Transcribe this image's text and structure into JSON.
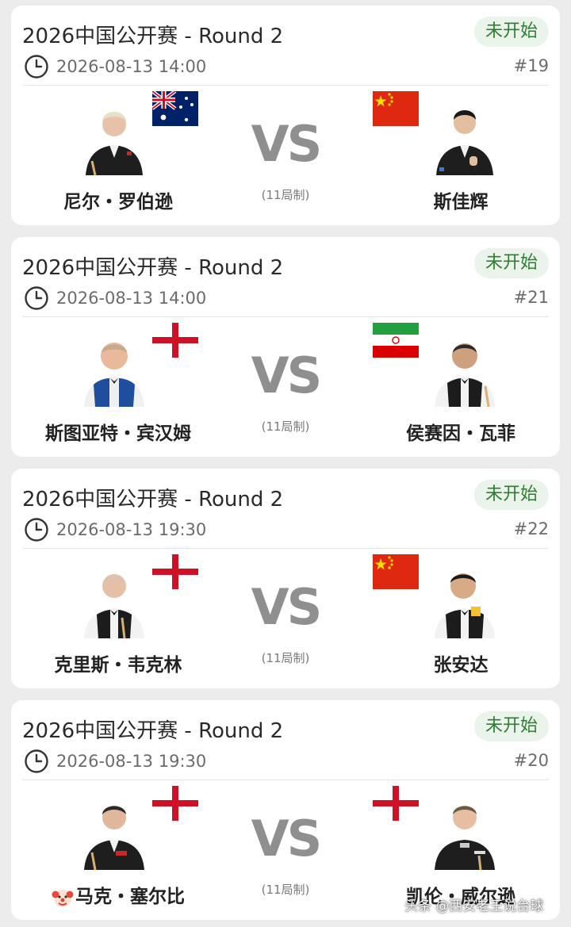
{
  "colors": {
    "status_bg": "#eaf4ea",
    "status_text": "#2e7d32",
    "vs": "#8f8f8f",
    "card_bg": "#ffffff",
    "page_bg": "#ececec"
  },
  "matches": [
    {
      "title": "2026中国公开赛 - Round 2",
      "status": "未开始",
      "time": "2026-08-13 14:00",
      "number": "#19",
      "vs": "VS",
      "format": "(11局制)",
      "left": {
        "name": "尼尔・罗伯逊",
        "flag": "australia-flag"
      },
      "right": {
        "name": "斯佳辉",
        "flag": "china-flag"
      }
    },
    {
      "title": "2026中国公开赛 - Round 2",
      "status": "未开始",
      "time": "2026-08-13 14:00",
      "number": "#21",
      "vs": "VS",
      "format": "(11局制)",
      "left": {
        "name": "斯图亚特・宾汉姆",
        "flag": "england-flag"
      },
      "right": {
        "name": "侯赛因・瓦菲",
        "flag": "iran-flag"
      }
    },
    {
      "title": "2026中国公开赛 - Round 2",
      "status": "未开始",
      "time": "2026-08-13 19:30",
      "number": "#22",
      "vs": "VS",
      "format": "(11局制)",
      "left": {
        "name": "克里斯・韦克林",
        "flag": "england-flag"
      },
      "right": {
        "name": "张安达",
        "flag": "china-flag"
      }
    },
    {
      "title": "2026中国公开赛 - Round 2",
      "status": "未开始",
      "time": "2026-08-13 19:30",
      "number": "#20",
      "vs": "VS",
      "format": "(11局制)",
      "left": {
        "name": "马克・塞尔比",
        "flag": "england-flag",
        "emoji": "clown-face-icon"
      },
      "right": {
        "name": "凯伦・威尔逊",
        "flag": "england-flag"
      }
    }
  ],
  "watermark": "头条 @西安老王说台球"
}
